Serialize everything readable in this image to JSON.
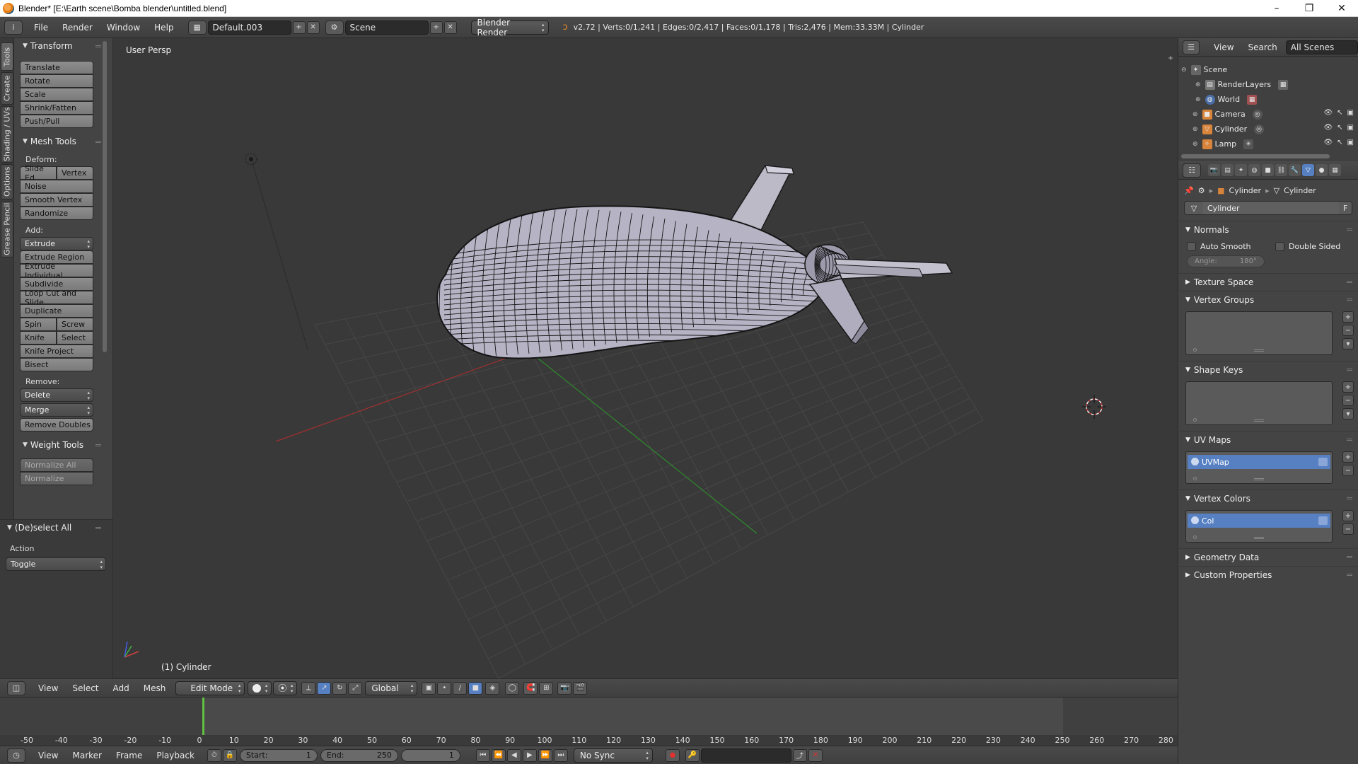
{
  "window": {
    "title": "Blender* [E:\\Earth scene\\Bomba blender\\untitled.blend]",
    "min_glyph": "–",
    "restore_glyph": "❐",
    "close_glyph": "✕"
  },
  "info": {
    "menus": [
      "File",
      "Render",
      "Window",
      "Help"
    ],
    "layout": "Default.003",
    "scene": "Scene",
    "engine": "Blender Render",
    "stats": "v2.72 | Verts:0/1,241 | Edges:0/2,417 | Faces:0/1,178 | Tris:2,476 | Mem:33.33M | Cylinder"
  },
  "tool_tabs": [
    "Tools",
    "Create",
    "Shading / UVs",
    "Options",
    "Grease Pencil"
  ],
  "toolshelf": {
    "transform": {
      "title": "Transform",
      "buttons": [
        "Translate",
        "Rotate",
        "Scale",
        "Shrink/Fatten",
        "Push/Pull"
      ]
    },
    "mesh_tools": {
      "title": "Mesh Tools",
      "deform_label": "Deform:",
      "slide_edge": "Slide Ed",
      "vertex": "Vertex",
      "deform_buttons": [
        "Noise",
        "Smooth Vertex",
        "Randomize"
      ],
      "add_label": "Add:",
      "extrude": "Extrude",
      "add_buttons": [
        "Extrude Region",
        "Extrude Individual",
        "Subdivide",
        "Loop Cut and Slide",
        "Duplicate"
      ],
      "spin": "Spin",
      "screw": "Screw",
      "knife": "Knife",
      "select": "Select",
      "knife_project": "Knife Project",
      "bisect": "Bisect",
      "remove_label": "Remove:",
      "delete": "Delete",
      "merge": "Merge",
      "remove_doubles": "Remove Doubles"
    },
    "weight_tools": {
      "title": "Weight Tools",
      "normalize_all": "Normalize All",
      "normalize": "Normalize"
    }
  },
  "operator": {
    "title": "(De)select All",
    "action_label": "Action",
    "action_value": "Toggle"
  },
  "viewport": {
    "label": "User Persp",
    "object_label": "(1) Cylinder"
  },
  "view3d_header": {
    "menus": [
      "View",
      "Select",
      "Add",
      "Mesh"
    ],
    "mode": "Edit Mode",
    "orientation": "Global"
  },
  "timeline": {
    "ticks": [
      "-50",
      "-40",
      "-30",
      "-20",
      "-10",
      "0",
      "10",
      "20",
      "30",
      "40",
      "50",
      "60",
      "70",
      "80",
      "90",
      "100",
      "110",
      "120",
      "130",
      "140",
      "150",
      "160",
      "170",
      "180",
      "190",
      "200",
      "210",
      "220",
      "230",
      "240",
      "250",
      "260",
      "270",
      "280"
    ],
    "menus": [
      "View",
      "Marker",
      "Frame",
      "Playback"
    ],
    "start_label": "Start:",
    "start_value": "1",
    "end_label": "End:",
    "end_value": "250",
    "current_frame": "1",
    "sync": "No Sync"
  },
  "outliner": {
    "view": "View",
    "search": "Search",
    "filter": "All Scenes",
    "items": [
      "Scene",
      "RenderLayers",
      "World",
      "Camera",
      "Cylinder",
      "Lamp"
    ]
  },
  "properties": {
    "breadcrumb_object": "Cylinder",
    "breadcrumb_mesh": "Cylinder",
    "mesh_name": "Cylinder",
    "fake_user": "F",
    "normals": {
      "title": "Normals",
      "auto_smooth": "Auto Smooth",
      "double_sided": "Double Sided",
      "angle_label": "Angle:",
      "angle_value": "180°"
    },
    "texture_space": "Texture Space",
    "vertex_groups": "Vertex Groups",
    "shape_keys": "Shape Keys",
    "uv_maps": {
      "title": "UV Maps",
      "item": "UVMap"
    },
    "vertex_colors": {
      "title": "Vertex Colors",
      "item": "Col"
    },
    "geometry_data": "Geometry Data",
    "custom_properties": "Custom Properties"
  },
  "colors": {
    "accent": "#5680c2",
    "viewport_bg": "#393939",
    "grid": "#474747",
    "x_axis": "#a03030",
    "y_axis": "#2e8a2e",
    "mesh_fill": "#b6b3c4",
    "wire": "#141414"
  }
}
